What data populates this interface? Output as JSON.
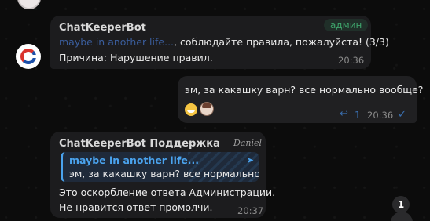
{
  "messages": [
    {
      "sender": "ChatKeeperBot",
      "role_badge": "админ",
      "line1_link": "maybe in another life...",
      "line1_rest": ", соблюдайте правила, пожалуйста! (3/3)",
      "line2": "Причина:  Нарушение правил.",
      "time": "20:36"
    },
    {
      "text": "эм, за какашку варн? все нормально вообще?",
      "emoji_1": "grinning-face-emoji",
      "emoji_2": "user-avatar-reaction",
      "reply_count": "1",
      "time": "20:36"
    },
    {
      "sender": "ChatKeeperBot Поддержка",
      "signature": "Daniel",
      "quote_author": "maybe in another life...",
      "quote_text": "эм, за какашку варн? все нормально...",
      "line1": "Это оскорбление ответа Администрации.",
      "line2": "Не нравится ответ промолчи.",
      "time": "20:37"
    }
  ],
  "unread_badge": "1",
  "colors": {
    "background": "#0c0c0c",
    "bubble": "#1c1c1e",
    "admin_badge": "#3ea36b",
    "link": "#4aa3ee",
    "check": "#3a6fb0"
  }
}
